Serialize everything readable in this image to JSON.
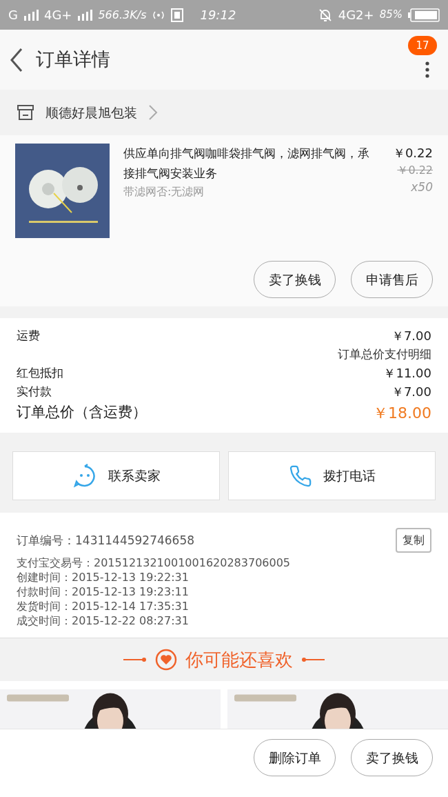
{
  "status_bar": {
    "carrier_1": "G",
    "carrier_2": "4G+",
    "speed": "566.3K/s",
    "time": "19:12",
    "network_right": "4G2+",
    "battery": "85%"
  },
  "header": {
    "title": "订单详情",
    "badge": "17"
  },
  "shop": {
    "name": "顺德好晨旭包装"
  },
  "product": {
    "title": "供应单向排气阀咖啡袋排气阀，滤网排气阀，承接排气阀安装业务",
    "spec": "带滤网否:无滤网",
    "price": "￥0.22",
    "original_price": "￥0.22",
    "quantity": "x50",
    "actions": [
      "卖了换钱",
      "申请售后"
    ]
  },
  "costs": [
    {
      "kind": "row",
      "label": "运费",
      "value": "￥7.00"
    },
    {
      "kind": "note",
      "value": "订单总价支付明细"
    },
    {
      "kind": "row",
      "label": "红包抵扣",
      "value": "￥11.00"
    },
    {
      "kind": "row",
      "label": "实付款",
      "value": "￥7.00"
    },
    {
      "kind": "total",
      "label": "订单总价（含运费）",
      "value": "￥18.00"
    }
  ],
  "contact": [
    {
      "kind": "chat",
      "label": "联系卖家"
    },
    {
      "kind": "phone",
      "label": "拨打电话"
    }
  ],
  "order_info": {
    "number": "订单编号：1431144592746658",
    "copy": "复制",
    "lines": [
      "支付宝交易号：2015121321001001620283706005",
      "创建时间：2015-12-13 19:22:31",
      "付款时间：2015-12-13 19:23:11",
      "发货时间：2015-12-14 17:35:31",
      "成交时间：2015-12-22 08:27:31"
    ]
  },
  "recommend": {
    "title": "你可能还喜欢"
  },
  "bottom_actions": [
    "删除订单",
    "卖了换钱"
  ]
}
